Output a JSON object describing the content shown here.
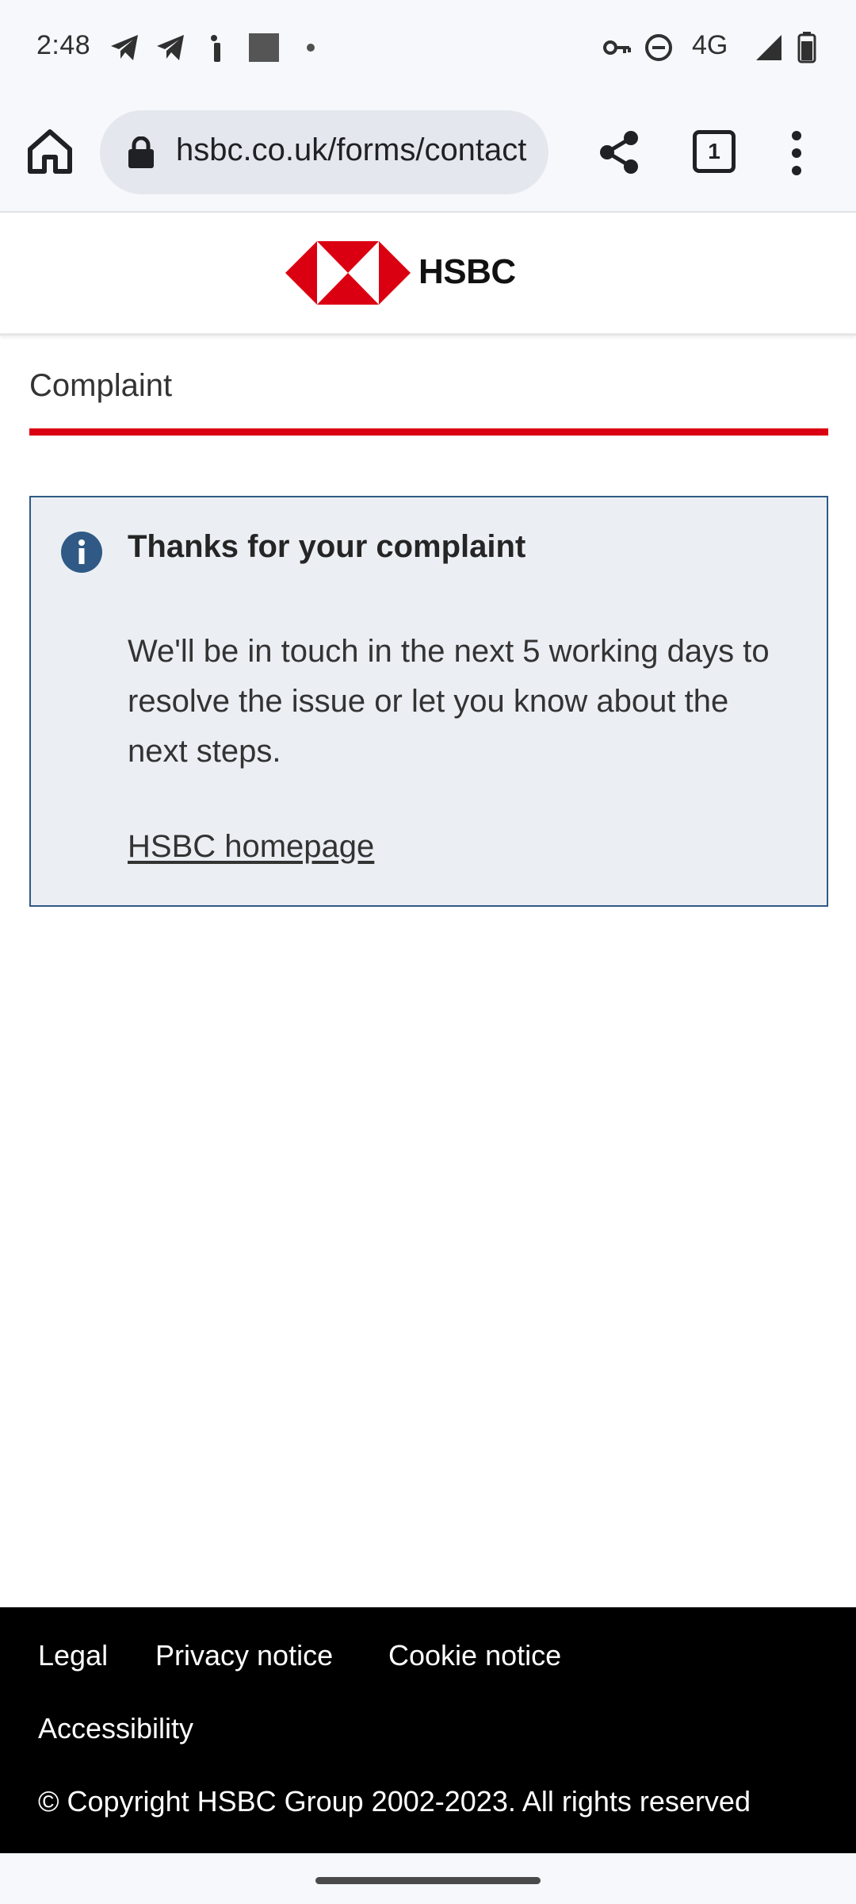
{
  "status_bar": {
    "time": "2:48",
    "network": "4G",
    "left_icons": [
      "telegram-icon",
      "telegram-icon",
      "notification-icon",
      "image-icon",
      "dot-icon"
    ],
    "right_icons": [
      "vpn-key-icon",
      "do-not-disturb-icon",
      "signal-icon",
      "battery-icon"
    ]
  },
  "browser": {
    "url": "hsbc.co.uk/forms/contact",
    "tab_count": "1"
  },
  "brand": {
    "name": "HSBC",
    "red": "#db0011"
  },
  "page": {
    "title": "Complaint"
  },
  "notice": {
    "title": "Thanks for your complaint",
    "body": "We'll be in touch in the next 5 working days to resolve the issue or let you know about the next steps.",
    "link": "HSBC homepage",
    "icon": "info-icon",
    "icon_color": "#305a85"
  },
  "footer": {
    "links": [
      "Legal",
      "Privacy notice",
      "Cookie notice",
      "Accessibility"
    ],
    "copyright": "© Copyright HSBC Group 2002-2023. All rights reserved"
  }
}
